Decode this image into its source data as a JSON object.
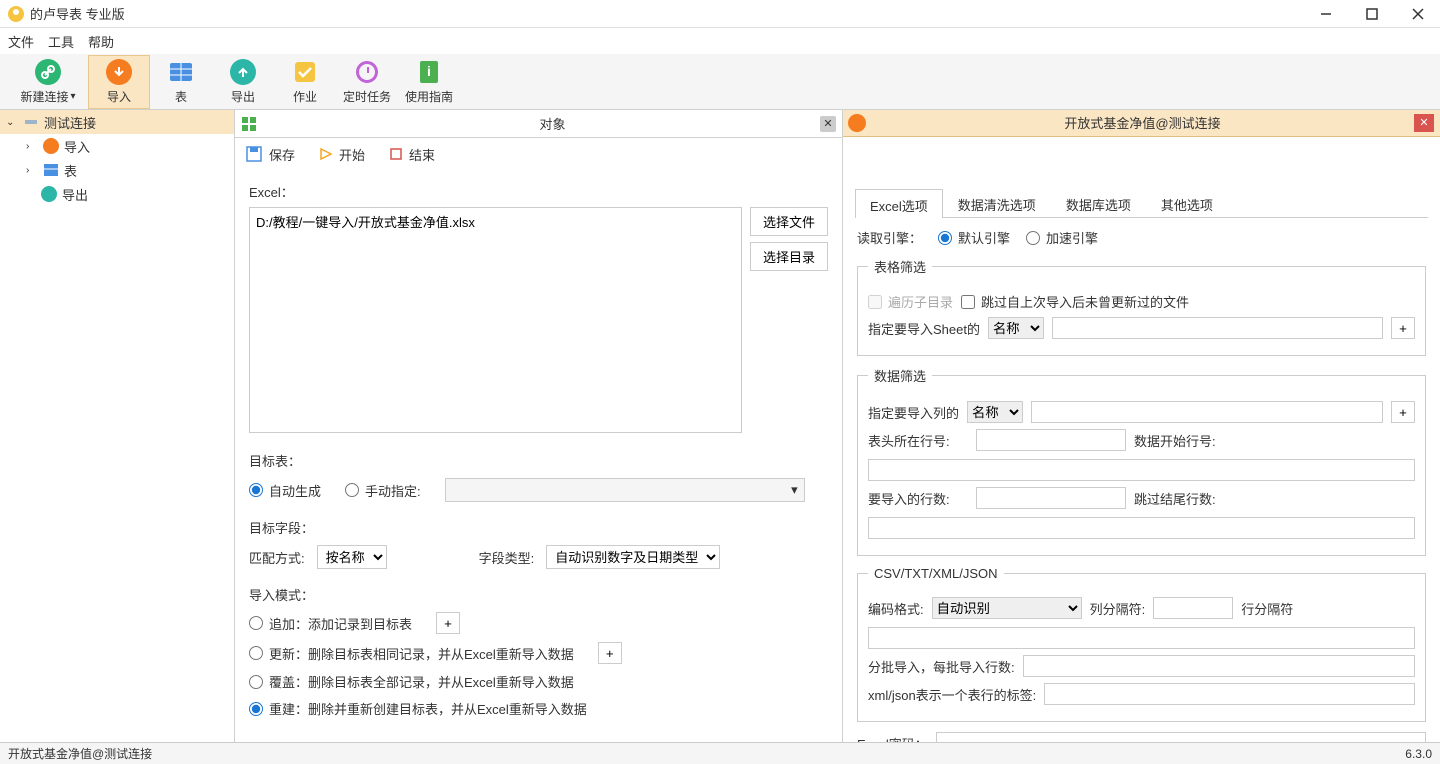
{
  "titlebar": {
    "title": "的卢导表 专业版"
  },
  "menubar": {
    "file": "文件",
    "tools": "工具",
    "help": "帮助"
  },
  "toolbar": {
    "new_conn": "新建连接",
    "import": "导入",
    "table": "表",
    "export": "导出",
    "job": "作业",
    "cron": "定时任务",
    "guide": "使用指南"
  },
  "sidebar": {
    "root": "测试连接",
    "import": "导入",
    "table": "表",
    "export": "导出"
  },
  "center": {
    "object_tab": "对象",
    "save": "保存",
    "start": "开始",
    "end": "结束",
    "excel_label": "Excel：",
    "file_path": "D:/教程/一键导入/开放式基金净值.xlsx",
    "choose_file": "选择文件",
    "choose_dir": "选择目录",
    "target_table_label": "目标表：",
    "auto_gen": "自动生成",
    "manual": "手动指定:",
    "target_field_label": "目标字段：",
    "match_method": "匹配方式:",
    "match_method_val": "按名称",
    "field_type": "字段类型:",
    "field_type_val": "自动识别数字及日期类型",
    "import_mode_label": "导入模式：",
    "mode_append": "追加：添加记录到目标表",
    "mode_update": "更新：删除目标表相同记录，并从Excel重新导入数据",
    "mode_cover": "覆盖：删除目标表全部记录，并从Excel重新导入数据",
    "mode_rebuild": "重建：删除并重新创建目标表，并从Excel重新导入数据"
  },
  "right": {
    "tab_title": "开放式基金净值@测试连接",
    "sub_tabs": {
      "excel": "Excel选项",
      "clean": "数据清洗选项",
      "db": "数据库选项",
      "other": "其他选项"
    },
    "engine_label": "读取引擎：",
    "engine_default": "默认引擎",
    "engine_fast": "加速引擎",
    "group_table_filter": "表格筛选",
    "cb_recurse": "遍历子目录",
    "cb_skip": "跳过自上次导入后未曾更新过的文件",
    "sheet_label": "指定要导入Sheet的",
    "sheet_by": "名称",
    "group_data_filter": "数据筛选",
    "col_label": "指定要导入列的",
    "col_by": "名称",
    "header_row": "表头所在行号:",
    "data_start_row": "数据开始行号:",
    "import_rows": "要导入的行数:",
    "skip_tail": "跳过结尾行数:",
    "group_csv": "CSV/TXT/XML/JSON",
    "encoding_label": "编码格式:",
    "encoding_val": "自动识别",
    "col_delim": "列分隔符:",
    "row_delim": "行分隔符",
    "batch_label": "分批导入，每批导入行数:",
    "xml_label": "xml/json表示一个表行的标签:",
    "excel_pwd": "Excel密码："
  },
  "statusbar": {
    "left": "开放式基金净值@测试连接",
    "right": "6.3.0"
  }
}
